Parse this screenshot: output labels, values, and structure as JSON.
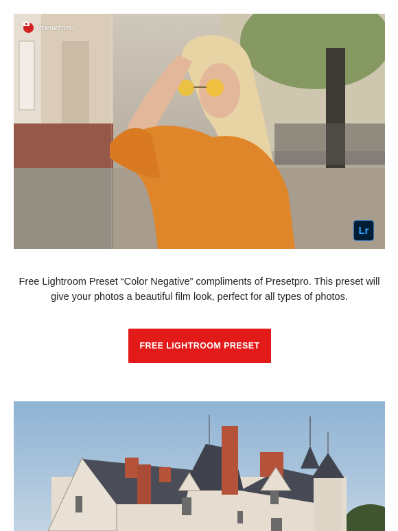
{
  "hero": {
    "brand": "Presetpro",
    "brand_icon": "camera-icon",
    "badge": "Lr"
  },
  "description": "Free Lightroom Preset “Color Negative” compliments of Presetpro. This preset will give your photos a beautiful film look, perfect for all types of photos.",
  "cta": {
    "label": "FREE LIGHTROOM PRESET",
    "color": "#e31a1a"
  },
  "castle_image": {}
}
